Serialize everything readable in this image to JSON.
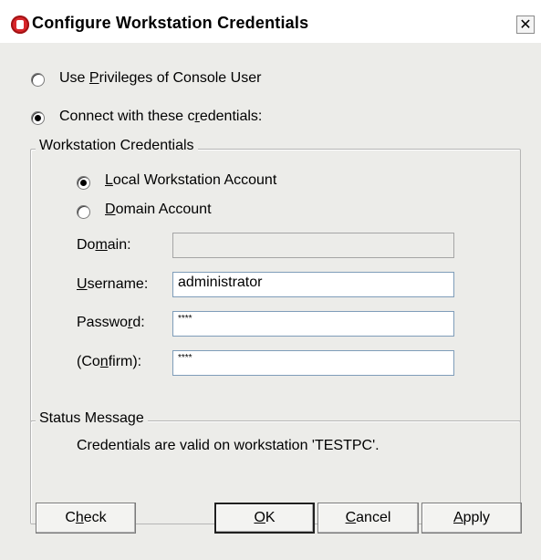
{
  "window": {
    "title": "Configure Workstation Credentials",
    "close_label": "✕"
  },
  "mode_options": [
    {
      "label_pre": "Use ",
      "mnemonic": "P",
      "label_post": "rivileges of Console User",
      "selected": false
    },
    {
      "label_pre": "Connect with these c",
      "mnemonic": "r",
      "label_post": "edentials:",
      "selected": true
    }
  ],
  "credentials_group": {
    "legend": "Workstation Credentials",
    "account_options": [
      {
        "label_pre": "",
        "mnemonic": "L",
        "label_post": "ocal Workstation Account",
        "selected": true
      },
      {
        "label_pre": "",
        "mnemonic": "D",
        "label_post": "omain Account",
        "selected": false
      }
    ],
    "domain": {
      "label_pre": "Do",
      "mnemonic": "m",
      "label_post": "ain:",
      "value": ""
    },
    "username": {
      "label_pre": "",
      "mnemonic": "U",
      "label_post": "sername:",
      "value": "administrator"
    },
    "password": {
      "label_pre": "Passwo",
      "mnemonic": "r",
      "label_post": "d:",
      "value": "****"
    },
    "confirm": {
      "label_pre": "(Co",
      "mnemonic": "n",
      "label_post": "firm):",
      "value": "****"
    }
  },
  "status_group": {
    "legend": "Status Message",
    "message": "Credentials are valid on workstation 'TESTPC'."
  },
  "buttons": {
    "check": {
      "label_pre": "C",
      "mnemonic": "h",
      "label_post": "eck"
    },
    "ok": {
      "label_pre": "",
      "mnemonic": "O",
      "label_post": "K"
    },
    "cancel": {
      "label_pre": "",
      "mnemonic": "C",
      "label_post": "ancel"
    },
    "apply": {
      "label_pre": "",
      "mnemonic": "A",
      "label_post": "pply"
    }
  }
}
